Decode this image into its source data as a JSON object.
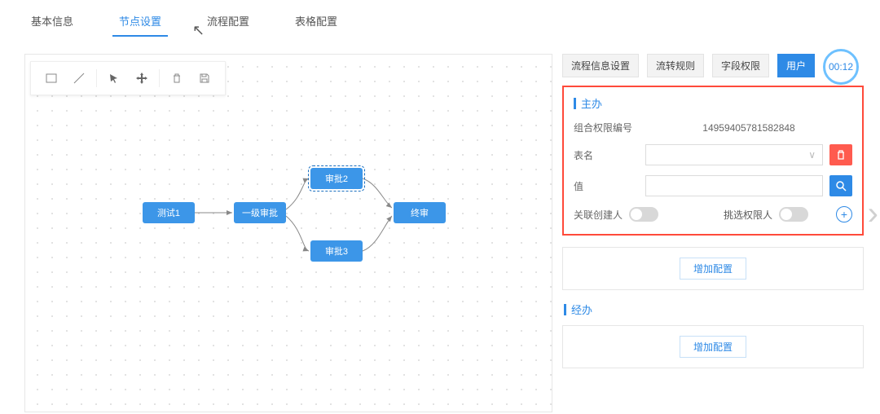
{
  "tabs": {
    "t0": "基本信息",
    "t1": "节点设置",
    "t2": "流程配置",
    "t3": "表格配置"
  },
  "nodes": {
    "n0": "测试1",
    "n1": "一级审批",
    "n2": "审批2",
    "n3": "审批3",
    "n4": "终审"
  },
  "rtabs": {
    "r0": "流程信息设置",
    "r1": "流转规则",
    "r2": "字段权限",
    "r3": "用户"
  },
  "panel": {
    "zhuban_title": "主办",
    "jingban_title": "经办",
    "comb_label": "组合权限编号",
    "comb_value": "14959405781582848",
    "table_label": "表名",
    "value_label": "值",
    "link_creator": "关联创建人",
    "pick_perm": "挑选权限人",
    "add_config": "增加配置",
    "select_arrow": "∨"
  },
  "timer": "00:12"
}
